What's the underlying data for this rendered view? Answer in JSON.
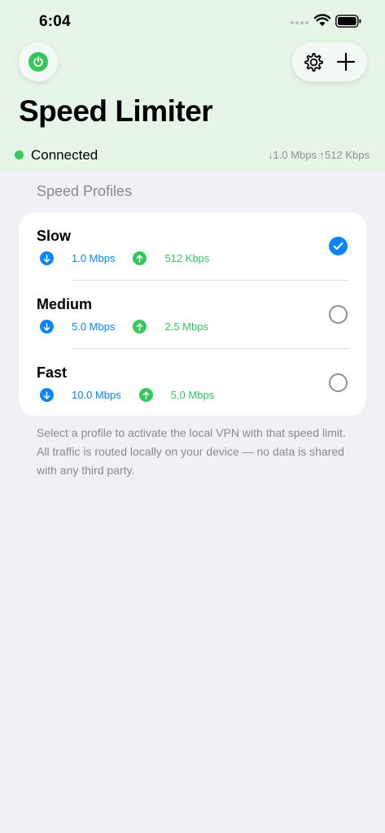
{
  "status_bar": {
    "time": "6:04"
  },
  "header": {
    "title": "Speed Limiter",
    "connection": {
      "label": "Connected",
      "speeds": "↓1.0 Mbps ↑512 Kbps",
      "status_color": "#34c759"
    }
  },
  "section": {
    "title": "Speed Profiles"
  },
  "profiles": [
    {
      "name": "Slow",
      "download": "1.0 Mbps",
      "upload": "512 Kbps",
      "selected": true
    },
    {
      "name": "Medium",
      "download": "5.0 Mbps",
      "upload": "2.5 Mbps",
      "selected": false
    },
    {
      "name": "Fast",
      "download": "10.0 Mbps",
      "upload": "5.0 Mbps",
      "selected": false
    }
  ],
  "footnote": "Select a profile to activate the local VPN with that speed limit. All traffic is routed locally on your device — no data is shared with any third party.",
  "colors": {
    "accent_blue": "#0a84ff",
    "accent_green": "#34c759",
    "header_bg": "#e6f5e8"
  },
  "icons": {
    "power": "power-icon",
    "settings": "gear-icon",
    "add": "plus-icon"
  }
}
